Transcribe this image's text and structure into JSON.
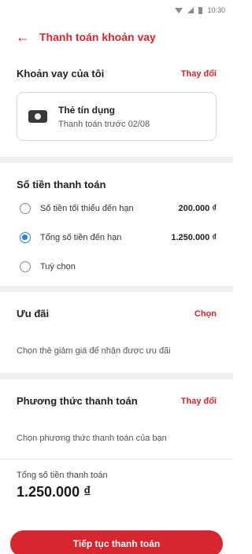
{
  "status_bar": {
    "time": "10:30"
  },
  "header": {
    "title": "Thanh toán khoản vay"
  },
  "loan": {
    "title": "Khoản vay của tôi",
    "action": "Thay đổi",
    "card_name": "Thẻ tín dụng",
    "card_due": "Thanh toán trước 02/08"
  },
  "payment_amount": {
    "title": "Số tiền thanh toán",
    "options": [
      {
        "label": "Số tiền tối thiểu đến hạn",
        "amount": "200.000 ₫",
        "selected": false
      },
      {
        "label": "Tổng số tiền đến hạn",
        "amount": "1.250.000 ₫",
        "selected": true
      },
      {
        "label": "Tuỳ chọn",
        "amount": "",
        "selected": false
      }
    ]
  },
  "offers": {
    "title": "Ưu đãi",
    "action": "Chọn",
    "hint": "Chọn thẻ giảm giá để nhận được ưu đãi"
  },
  "payment_method": {
    "title": "Phương thức thanh toán",
    "action": "Thay đổi",
    "hint": "Chọn phương thức thanh toán của bạn"
  },
  "footer": {
    "total_label": "Tổng số tiền thanh toán",
    "total_amount": "1.250.000 ₫",
    "cta_label": "Tiếp tục thanh toán"
  },
  "colors": {
    "accent": "#d7262f",
    "radio_selected": "#2f7fd8",
    "divider": "#efefef"
  },
  "icons": {
    "back": "arrow-left-icon",
    "card": "credit-card-icon"
  }
}
